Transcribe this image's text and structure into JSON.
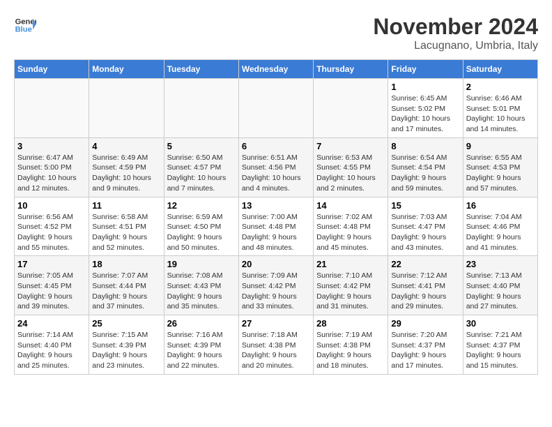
{
  "header": {
    "logo_line1": "General",
    "logo_line2": "Blue",
    "month": "November 2024",
    "location": "Lacugnano, Umbria, Italy"
  },
  "weekdays": [
    "Sunday",
    "Monday",
    "Tuesday",
    "Wednesday",
    "Thursday",
    "Friday",
    "Saturday"
  ],
  "weeks": [
    {
      "days": [
        {
          "num": "",
          "info": ""
        },
        {
          "num": "",
          "info": ""
        },
        {
          "num": "",
          "info": ""
        },
        {
          "num": "",
          "info": ""
        },
        {
          "num": "",
          "info": ""
        },
        {
          "num": "1",
          "info": "Sunrise: 6:45 AM\nSunset: 5:02 PM\nDaylight: 10 hours\nand 17 minutes."
        },
        {
          "num": "2",
          "info": "Sunrise: 6:46 AM\nSunset: 5:01 PM\nDaylight: 10 hours\nand 14 minutes."
        }
      ]
    },
    {
      "days": [
        {
          "num": "3",
          "info": "Sunrise: 6:47 AM\nSunset: 5:00 PM\nDaylight: 10 hours\nand 12 minutes."
        },
        {
          "num": "4",
          "info": "Sunrise: 6:49 AM\nSunset: 4:59 PM\nDaylight: 10 hours\nand 9 minutes."
        },
        {
          "num": "5",
          "info": "Sunrise: 6:50 AM\nSunset: 4:57 PM\nDaylight: 10 hours\nand 7 minutes."
        },
        {
          "num": "6",
          "info": "Sunrise: 6:51 AM\nSunset: 4:56 PM\nDaylight: 10 hours\nand 4 minutes."
        },
        {
          "num": "7",
          "info": "Sunrise: 6:53 AM\nSunset: 4:55 PM\nDaylight: 10 hours\nand 2 minutes."
        },
        {
          "num": "8",
          "info": "Sunrise: 6:54 AM\nSunset: 4:54 PM\nDaylight: 9 hours\nand 59 minutes."
        },
        {
          "num": "9",
          "info": "Sunrise: 6:55 AM\nSunset: 4:53 PM\nDaylight: 9 hours\nand 57 minutes."
        }
      ]
    },
    {
      "days": [
        {
          "num": "10",
          "info": "Sunrise: 6:56 AM\nSunset: 4:52 PM\nDaylight: 9 hours\nand 55 minutes."
        },
        {
          "num": "11",
          "info": "Sunrise: 6:58 AM\nSunset: 4:51 PM\nDaylight: 9 hours\nand 52 minutes."
        },
        {
          "num": "12",
          "info": "Sunrise: 6:59 AM\nSunset: 4:50 PM\nDaylight: 9 hours\nand 50 minutes."
        },
        {
          "num": "13",
          "info": "Sunrise: 7:00 AM\nSunset: 4:48 PM\nDaylight: 9 hours\nand 48 minutes."
        },
        {
          "num": "14",
          "info": "Sunrise: 7:02 AM\nSunset: 4:48 PM\nDaylight: 9 hours\nand 45 minutes."
        },
        {
          "num": "15",
          "info": "Sunrise: 7:03 AM\nSunset: 4:47 PM\nDaylight: 9 hours\nand 43 minutes."
        },
        {
          "num": "16",
          "info": "Sunrise: 7:04 AM\nSunset: 4:46 PM\nDaylight: 9 hours\nand 41 minutes."
        }
      ]
    },
    {
      "days": [
        {
          "num": "17",
          "info": "Sunrise: 7:05 AM\nSunset: 4:45 PM\nDaylight: 9 hours\nand 39 minutes."
        },
        {
          "num": "18",
          "info": "Sunrise: 7:07 AM\nSunset: 4:44 PM\nDaylight: 9 hours\nand 37 minutes."
        },
        {
          "num": "19",
          "info": "Sunrise: 7:08 AM\nSunset: 4:43 PM\nDaylight: 9 hours\nand 35 minutes."
        },
        {
          "num": "20",
          "info": "Sunrise: 7:09 AM\nSunset: 4:42 PM\nDaylight: 9 hours\nand 33 minutes."
        },
        {
          "num": "21",
          "info": "Sunrise: 7:10 AM\nSunset: 4:42 PM\nDaylight: 9 hours\nand 31 minutes."
        },
        {
          "num": "22",
          "info": "Sunrise: 7:12 AM\nSunset: 4:41 PM\nDaylight: 9 hours\nand 29 minutes."
        },
        {
          "num": "23",
          "info": "Sunrise: 7:13 AM\nSunset: 4:40 PM\nDaylight: 9 hours\nand 27 minutes."
        }
      ]
    },
    {
      "days": [
        {
          "num": "24",
          "info": "Sunrise: 7:14 AM\nSunset: 4:40 PM\nDaylight: 9 hours\nand 25 minutes."
        },
        {
          "num": "25",
          "info": "Sunrise: 7:15 AM\nSunset: 4:39 PM\nDaylight: 9 hours\nand 23 minutes."
        },
        {
          "num": "26",
          "info": "Sunrise: 7:16 AM\nSunset: 4:39 PM\nDaylight: 9 hours\nand 22 minutes."
        },
        {
          "num": "27",
          "info": "Sunrise: 7:18 AM\nSunset: 4:38 PM\nDaylight: 9 hours\nand 20 minutes."
        },
        {
          "num": "28",
          "info": "Sunrise: 7:19 AM\nSunset: 4:38 PM\nDaylight: 9 hours\nand 18 minutes."
        },
        {
          "num": "29",
          "info": "Sunrise: 7:20 AM\nSunset: 4:37 PM\nDaylight: 9 hours\nand 17 minutes."
        },
        {
          "num": "30",
          "info": "Sunrise: 7:21 AM\nSunset: 4:37 PM\nDaylight: 9 hours\nand 15 minutes."
        }
      ]
    }
  ]
}
